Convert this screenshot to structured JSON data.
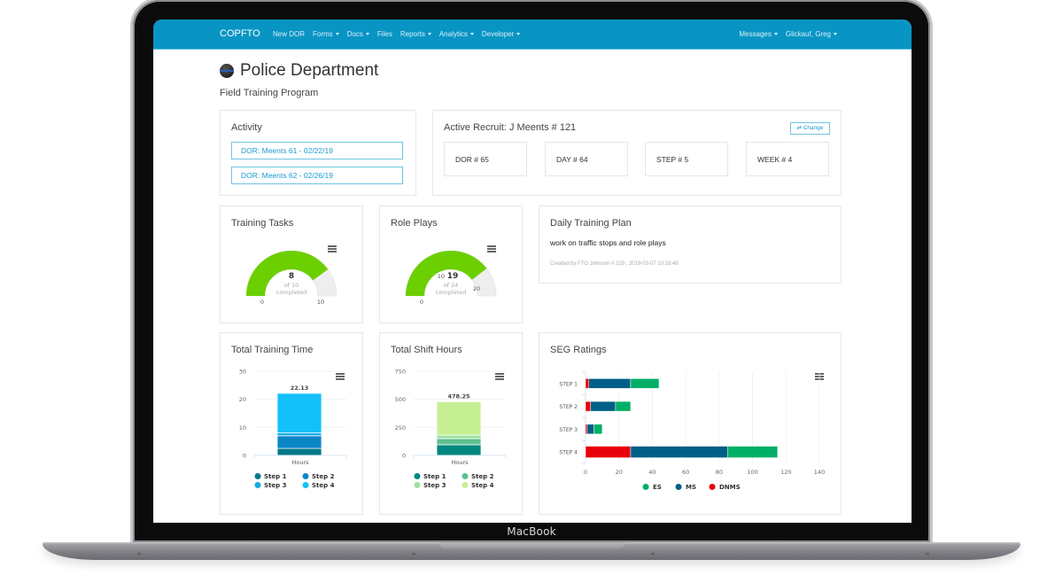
{
  "device": {
    "label": "MacBook"
  },
  "navbar": {
    "brand": "COPFTO",
    "items": [
      {
        "label": "New DOR",
        "dropdown": false
      },
      {
        "label": "Forms",
        "dropdown": true
      },
      {
        "label": "Docs",
        "dropdown": true
      },
      {
        "label": "Files",
        "dropdown": false
      },
      {
        "label": "Reports",
        "dropdown": true
      },
      {
        "label": "Analytics",
        "dropdown": true
      },
      {
        "label": "Developer",
        "dropdown": true
      }
    ],
    "right_items": [
      {
        "label": "Messages",
        "dropdown": true
      },
      {
        "label": "Glickauf, Greg",
        "dropdown": true
      }
    ],
    "color": "#0995c4"
  },
  "header": {
    "logo_icon": "police-badge-icon",
    "title": "Police Department",
    "subtitle": "Field Training Program"
  },
  "activity": {
    "title": "Activity",
    "links": [
      "DOR: Meents 61 - 02/22/19",
      "DOR: Meents 62 - 02/26/19"
    ]
  },
  "recruit": {
    "title": "Active Recruit: J Meents # 121",
    "change_label": "Change",
    "change_icon": "swap-arrows-icon",
    "stats": [
      "DOR # 65",
      "DAY # 64",
      "STEP # 5",
      "WEEK # 4"
    ]
  },
  "training_tasks": {
    "title": "Training Tasks",
    "value": "8",
    "caption_line1": "of 10",
    "caption_line2": "completed",
    "min_label": "0",
    "max_label": "10"
  },
  "role_plays": {
    "title": "Role Plays",
    "value": "19",
    "caption_line1": "of 24",
    "caption_line2": "completed",
    "min_label": "0",
    "tick_labels": [
      "10",
      "20"
    ]
  },
  "daily_plan": {
    "title": "Daily Training Plan",
    "text": "work on traffic stops and role plays",
    "meta": "Created by FTO Johnson # 229 , 2019-03-07 10:28:48"
  },
  "total_training_time": {
    "title": "Total Training Time"
  },
  "total_shift_hours": {
    "title": "Total Shift Hours"
  },
  "seg_ratings": {
    "title": "SEG Ratings"
  },
  "chart_data": [
    {
      "id": "training_tasks_gauge",
      "type": "gauge",
      "title": "Training Tasks",
      "value": 8,
      "min": 0,
      "max": 10,
      "color": "#6ccf00",
      "track_color": "#eeeeee"
    },
    {
      "id": "role_plays_gauge",
      "type": "gauge",
      "title": "Role Plays",
      "value": 19,
      "min": 0,
      "max": 24,
      "color": "#6ccf00",
      "track_color": "#eeeeee"
    },
    {
      "id": "total_training_time",
      "type": "bar",
      "stacked": true,
      "title": "Total Training Time",
      "categories": [
        "Hours"
      ],
      "ylim": [
        0,
        30
      ],
      "yticks": [
        0,
        10,
        20,
        30
      ],
      "total_label": "22.13",
      "series": [
        {
          "name": "Step 1",
          "values": [
            2.5
          ],
          "color": "#00788c"
        },
        {
          "name": "Step 2",
          "values": [
            4.5
          ],
          "color": "#0a86c7"
        },
        {
          "name": "Step 3",
          "values": [
            1.0
          ],
          "color": "#10a9e6"
        },
        {
          "name": "Step 4",
          "values": [
            14.13
          ],
          "color": "#14c0f8"
        }
      ],
      "legend": "bottom"
    },
    {
      "id": "total_shift_hours",
      "type": "bar",
      "stacked": true,
      "title": "Total Shift Hours",
      "categories": [
        "Hours"
      ],
      "ylim": [
        0,
        750
      ],
      "yticks": [
        0,
        250,
        500,
        750
      ],
      "total_label": "478.25",
      "series": [
        {
          "name": "Step 1",
          "values": [
            95
          ],
          "color": "#00877f"
        },
        {
          "name": "Step 2",
          "values": [
            55
          ],
          "color": "#5dbf8f"
        },
        {
          "name": "Step 3",
          "values": [
            30
          ],
          "color": "#9ee0a0"
        },
        {
          "name": "Step 4",
          "values": [
            298.25
          ],
          "color": "#c6ef94"
        }
      ],
      "legend": "bottom"
    },
    {
      "id": "seg_ratings",
      "type": "bar",
      "orientation": "horizontal",
      "stacked": true,
      "title": "SEG Ratings",
      "categories": [
        "STEP 1",
        "STEP 2",
        "STEP 3",
        "STEP 4"
      ],
      "xlim": [
        0,
        140
      ],
      "xticks": [
        0,
        20,
        40,
        60,
        80,
        100,
        120,
        140
      ],
      "series": [
        {
          "name": "DNMS",
          "values": [
            2,
            3,
            1,
            27
          ],
          "color": "#e8000b"
        },
        {
          "name": "MS",
          "values": [
            25,
            15,
            4,
            58
          ],
          "color": "#005f87"
        },
        {
          "name": "ES",
          "values": [
            17,
            9,
            5,
            30
          ],
          "color": "#00af66"
        }
      ],
      "legend_order": [
        "ES",
        "MS",
        "DNMS"
      ],
      "legend": "bottom"
    }
  ]
}
